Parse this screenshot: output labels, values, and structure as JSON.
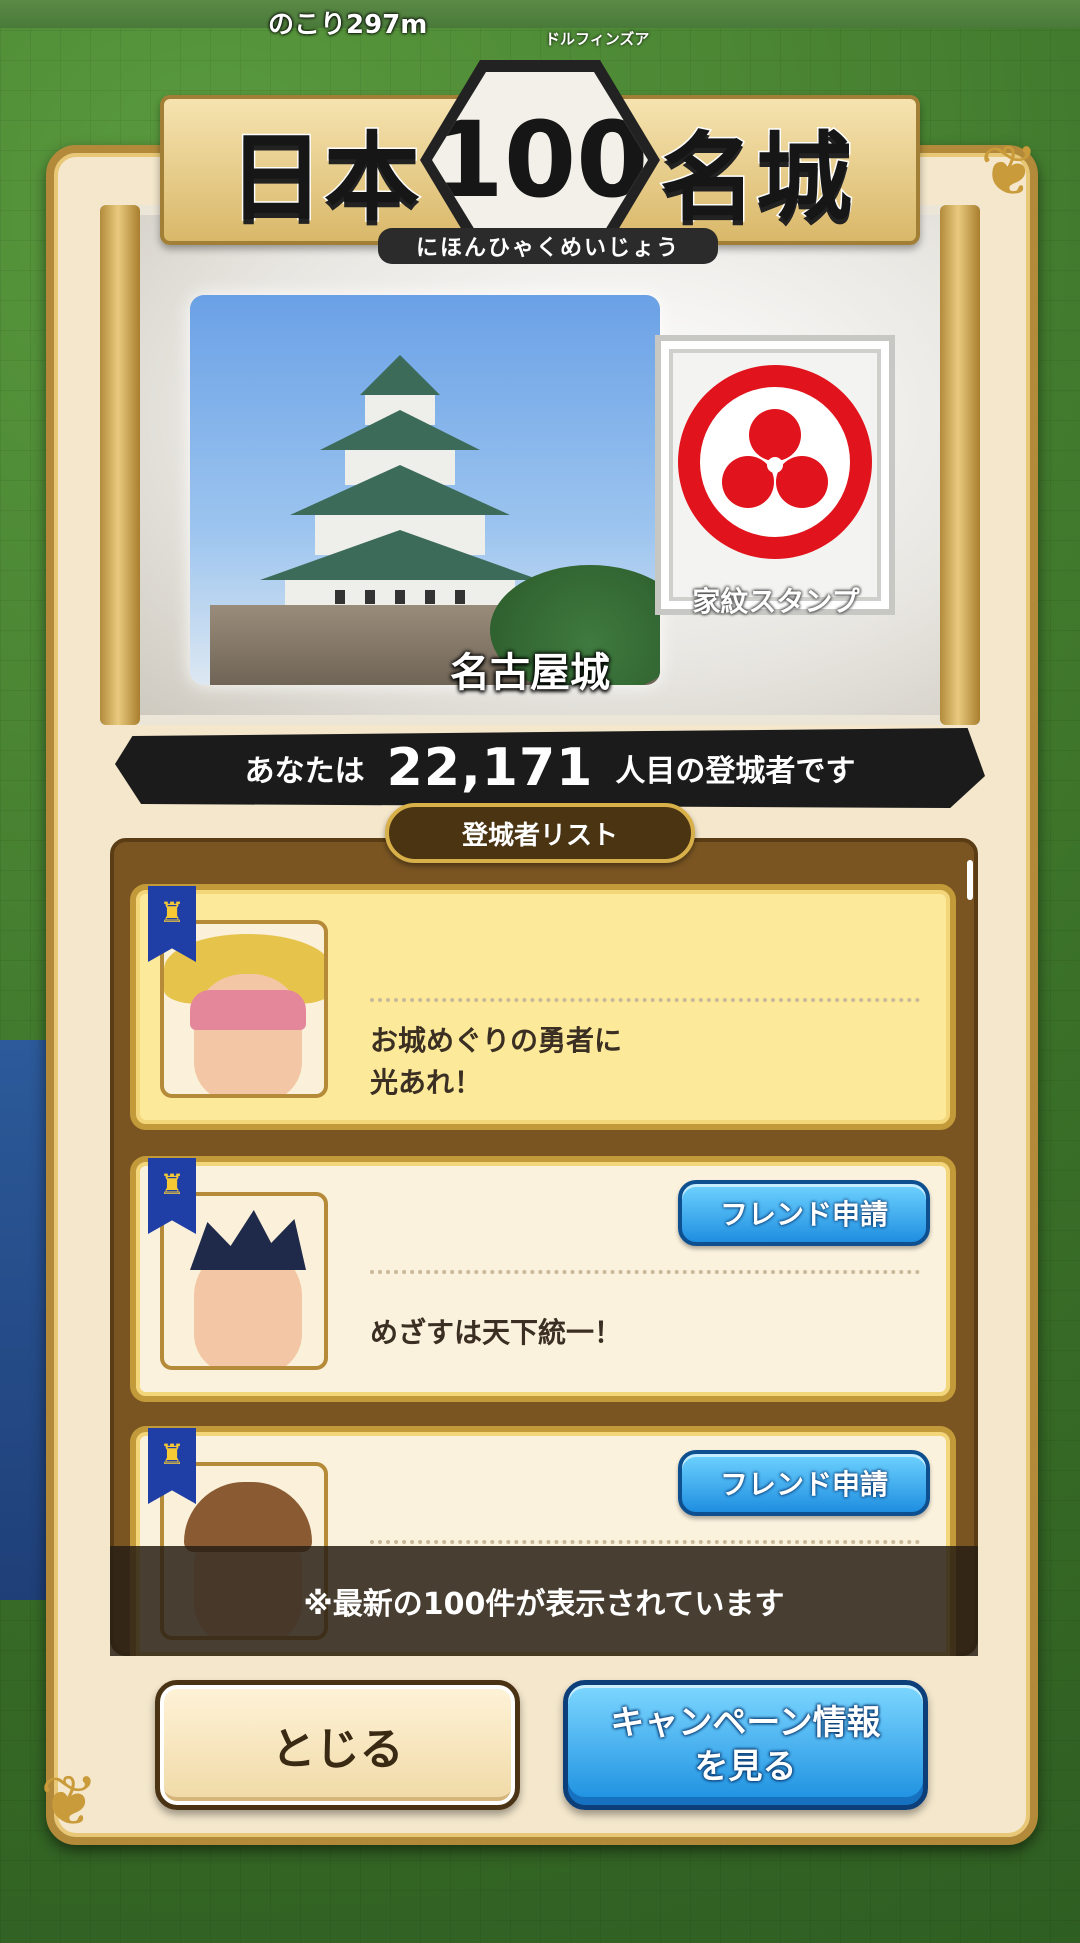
{
  "map": {
    "remaining_label": "のこり297m",
    "place_label": "ドルフィンズア"
  },
  "title": {
    "left": "日本",
    "number": "100",
    "right": "名城",
    "ruby": "にほんひゃくめいじょう"
  },
  "castle": {
    "name": "名古屋城",
    "stamp_label": "家紋スタンプ"
  },
  "visitor": {
    "prefix": "あなたは",
    "number": "22,171",
    "suffix": "人目の登城者です"
  },
  "list": {
    "tab_label": "登城者リスト",
    "entries": [
      {
        "message": "お城めぐりの勇者に\n光あれ！",
        "friend_button": ""
      },
      {
        "message": "めざすは天下統一！",
        "friend_button": "フレンド申請"
      },
      {
        "message": "",
        "friend_button": "フレンド申請"
      }
    ],
    "note": "※最新の100件が表示されています"
  },
  "buttons": {
    "close": "とじる",
    "campaign": "キャンペーン情報\nを見る"
  },
  "colors": {
    "panel": "#f4e7cc",
    "crest_red": "#e1141d",
    "button_blue": "#1f8ee0"
  }
}
